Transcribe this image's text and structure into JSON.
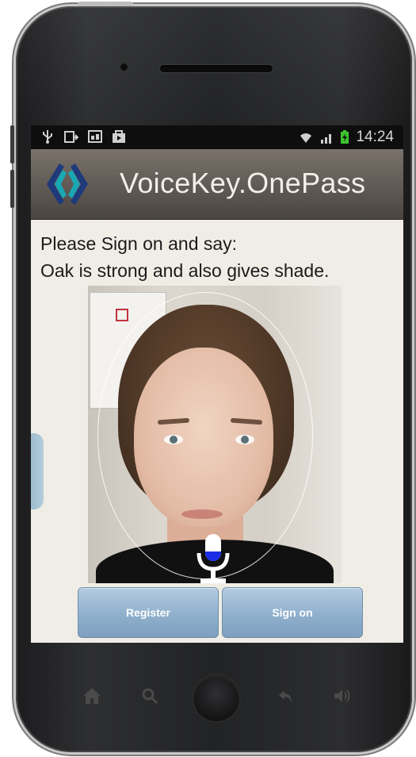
{
  "status_bar": {
    "time": "14:24",
    "left_icons": [
      "usb-icon",
      "upload-icon",
      "image-icon",
      "shopping-bag-icon"
    ],
    "right_icons": [
      "wifi-icon",
      "signal-icon",
      "battery-charging-icon"
    ]
  },
  "app_bar": {
    "title": "VoiceKey.OnePass",
    "logo_icon": "voicekey-logo-icon"
  },
  "prompt": {
    "line1": "Please Sign on and say:",
    "line2": "Oak is strong and also gives shade."
  },
  "camera": {
    "mic_icon": "microphone-icon",
    "mic_level_color": "#1a2ee6"
  },
  "buttons": {
    "register_label": "Register",
    "sign_on_label": "Sign on"
  },
  "nav_bar": {
    "icons": [
      "home-icon",
      "search-icon",
      "back-icon",
      "volume-icon"
    ]
  },
  "colors": {
    "logo_primary": "#1aa7b4",
    "logo_secondary": "#1e3a7a",
    "button_blue": "#8fb0cd",
    "app_bar": "#5e5751"
  }
}
